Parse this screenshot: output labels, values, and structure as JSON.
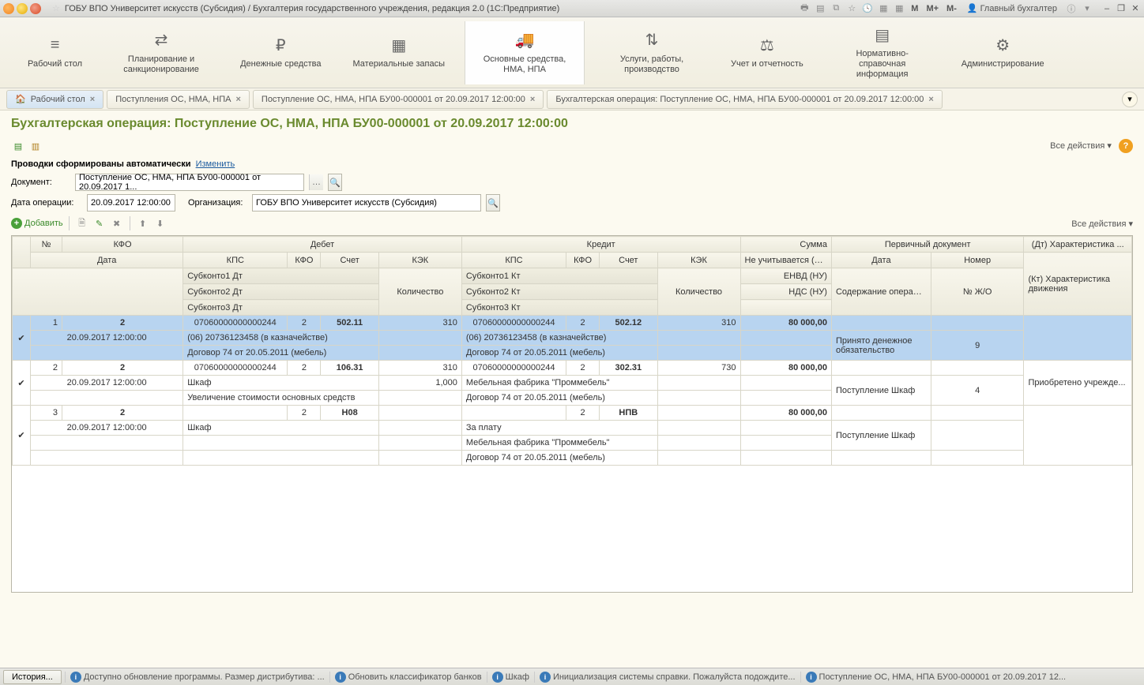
{
  "titlebar": {
    "title": "ГОБУ ВПО Университет искусств (Субсидия) / Бухгалтерия государственного учреждения, редакция 2.0  (1С:Предприятие)",
    "m": "M",
    "mplus": "M+",
    "mminus": "M-",
    "user": "Главный бухгалтер"
  },
  "sections": [
    {
      "icon": "≡",
      "label": "Рабочий стол"
    },
    {
      "icon": "⇄",
      "label": "Планирование и санкционирование"
    },
    {
      "icon": "₽",
      "label": "Денежные средства"
    },
    {
      "icon": "▦",
      "label": "Материальные запасы"
    },
    {
      "icon": "🚚",
      "label": "Основные средства, НМА, НПА"
    },
    {
      "icon": "⇅",
      "label": "Услуги, работы, производство"
    },
    {
      "icon": "⚖",
      "label": "Учет и отчетность"
    },
    {
      "icon": "▤",
      "label": "Нормативно-справочная информация"
    },
    {
      "icon": "⚙",
      "label": "Администрирование"
    }
  ],
  "tabs": [
    {
      "label": "Рабочий стол",
      "home": true
    },
    {
      "label": "Поступления ОС, НМА, НПА"
    },
    {
      "label": "Поступление ОС, НМА, НПА БУ00-000001 от 20.09.2017 12:00:00"
    },
    {
      "label": "Бухгалтерская операция: Поступление ОС, НМА, НПА БУ00-000001 от 20.09.2017 12:00:00"
    }
  ],
  "page": {
    "title": "Бухгалтерская операция: Поступление ОС, НМА, НПА БУ00-000001 от 20.09.2017 12:00:00",
    "all_actions": "Все действия ▾",
    "auto_label": "Проводки сформированы автоматически",
    "change_link": "Изменить",
    "doc_label": "Документ:",
    "doc_value": "Поступление ОС, НМА, НПА БУ00-000001 от 20.09.2017 1...",
    "date_label": "Дата операции:",
    "date_value": "20.09.2017 12:00:00",
    "org_label": "Организация:",
    "org_value": "ГОБУ ВПО Университет искусств (Субсидия)",
    "add_btn": "Добавить",
    "all_actions2": "Все действия ▾"
  },
  "headers": {
    "num": "№",
    "kfo": "КФО",
    "debit": "Дебет",
    "credit": "Кредит",
    "sum": "Сумма",
    "primary": "Первичный документ",
    "dt_char": "(Дт) Характеристика ...",
    "date": "Дата",
    "kps": "КПС",
    "kfo2": "КФО",
    "account": "Счет",
    "kek": "КЭК",
    "qty": "Количество",
    "not_counted": "Не учитывается (Н...",
    "date2": "Дата",
    "number": "Номер",
    "kt_char": "(Кт) Характеристика движения",
    "sub1dt": "Субконто1 Дт",
    "sub2dt": "Субконто2 Дт",
    "sub3dt": "Субконто3 Дт",
    "sub1kt": "Субконто1 Кт",
    "sub2kt": "Субконто2 Кт",
    "sub3kt": "Субконто3 Кт",
    "envd": "ЕНВД (НУ)",
    "nds": "НДС (НУ)",
    "desc": "Содержание операции",
    "jo": "№ Ж/О"
  },
  "rows": [
    {
      "n": "1",
      "kfo": "2",
      "date": "20.09.2017 12:00:00",
      "d_kps": "07060000000000244",
      "d_kfo": "2",
      "d_acc": "502.11",
      "d_kek": "310",
      "d_sub1": "(06) 20736123458 (в казначействе)",
      "d_sub2": "Договор 74 от 20.05.2011 (мебель)",
      "k_kps": "07060000000000244",
      "k_kfo": "2",
      "k_acc": "502.12",
      "k_kek": "310",
      "k_sub1": "(06) 20736123458 (в казначействе)",
      "k_sub2": "Договор 74 от 20.05.2011 (мебель)",
      "sum": "80 000,00",
      "desc": "Принято денежное обязательство",
      "jo": "9",
      "sel": true
    },
    {
      "n": "2",
      "kfo": "2",
      "date": "20.09.2017 12:00:00",
      "d_kps": "07060000000000244",
      "d_kfo": "2",
      "d_acc": "106.31",
      "d_kek": "310",
      "d_qty": "1,000",
      "d_sub1": "Шкаф",
      "d_sub2": "Увеличение стоимости основных средств",
      "k_kps": "07060000000000244",
      "k_kfo": "2",
      "k_acc": "302.31",
      "k_kek": "730",
      "k_sub1": "Мебельная фабрика \"Проммебель\"",
      "k_sub2": "Договор 74 от 20.05.2011 (мебель)",
      "sum": "80 000,00",
      "desc": "Поступление Шкаф",
      "jo": "4",
      "dt_char": "Приобретено учрежде..."
    },
    {
      "n": "3",
      "kfo": "2",
      "date": "20.09.2017 12:00:00",
      "d_kfo": "2",
      "d_acc": "Н08",
      "d_sub1": "Шкаф",
      "k_kfo": "2",
      "k_acc": "НПВ",
      "k_sub1": "За плату",
      "k_sub2": "Мебельная фабрика \"Проммебель\"",
      "k_sub3": "Договор 74 от 20.05.2011 (мебель)",
      "sum": "80 000,00",
      "desc": "Поступление Шкаф"
    }
  ],
  "statusbar": {
    "history": "История...",
    "items": [
      "Доступно обновление программы. Размер дистрибутива: ...",
      "Обновить классификатор банков",
      "Шкаф",
      "Инициализация системы справки. Пожалуйста подождите...",
      "Поступление ОС, НМА, НПА БУ00-000001 от 20.09.2017 12..."
    ]
  }
}
